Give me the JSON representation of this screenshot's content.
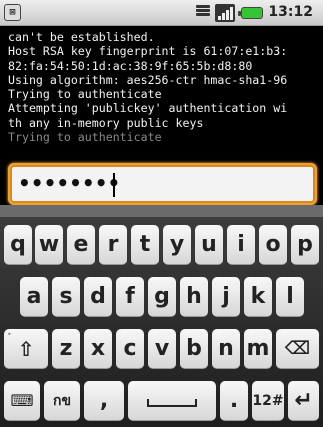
{
  "status_bar": {
    "time": "13:12",
    "app_icon_glyph": "⊠"
  },
  "terminal": {
    "lines": [
      "can't be established.",
      "Host RSA key fingerprint is 61:07:e1:b3:",
      "82:fa:54:50:1d:ac:38:9f:65:5b:d8:80",
      "Using algorithm: aes256-ctr hmac-sha1-96",
      "Trying to authenticate",
      "Attempting 'publickey' authentication wi",
      "th any in-memory public keys",
      "Trying to authenticate"
    ]
  },
  "password_input": {
    "value": "••••••••"
  },
  "keyboard": {
    "row1": [
      "q",
      "w",
      "e",
      "r",
      "t",
      "y",
      "u",
      "i",
      "o",
      "p"
    ],
    "row2": [
      "a",
      "s",
      "d",
      "f",
      "g",
      "h",
      "j",
      "k",
      "l"
    ],
    "row3": [
      "z",
      "x",
      "c",
      "v",
      "b",
      "n",
      "m"
    ],
    "shift_glyph": "⇧",
    "delete_glyph": "⌫",
    "lang_label": "กข",
    "comma_label": ",",
    "period_label": ".",
    "symbols_label": "12#",
    "enter_glyph": "↵",
    "keyboard_glyph": "⌨"
  },
  "colors": {
    "input_focus": "#f0a030",
    "battery": "#36c436"
  }
}
